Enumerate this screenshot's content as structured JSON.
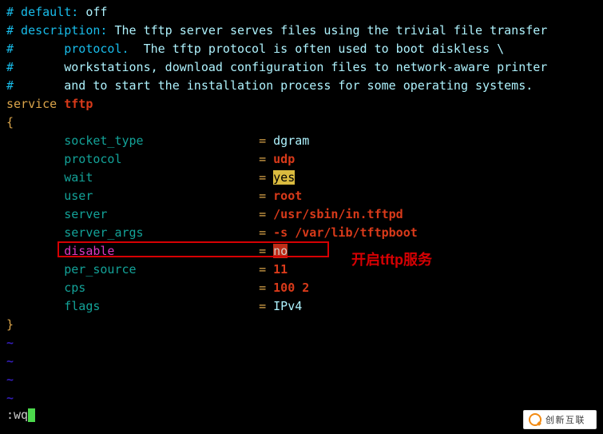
{
  "comments": {
    "l1_a": "# default: ",
    "l1_b": "off",
    "l2_a": "# description: ",
    "l2_b": "The tftp server serves files using the trivial file transfer",
    "l3_a": "#       protocol.  ",
    "l3_b": "The tftp protocol is often used to boot diskless \\",
    "l4_a": "#       ",
    "l4_b": "workstations, download configuration files to network-aware printer",
    "l5_a": "#       ",
    "l5_b": "and to start the installation process for some operating systems."
  },
  "svc": {
    "kw": "service ",
    "name": "tftp",
    "open": "{",
    "close": "}"
  },
  "rows": [
    {
      "k": "socket_type",
      "eq": "= ",
      "v": "dgram",
      "vc": "c-pale"
    },
    {
      "k": "protocol",
      "eq": "= ",
      "v": "udp",
      "vc": "c-red"
    },
    {
      "k": "wait",
      "eq": "= ",
      "v": "yes",
      "vc": "hl-hi"
    },
    {
      "k": "user",
      "eq": "= ",
      "v": "root",
      "vc": "c-red"
    },
    {
      "k": "server",
      "eq": "= ",
      "v": "/usr/sbin/in.tftpd",
      "vc": "c-red"
    },
    {
      "k": "server_args",
      "eq": "= ",
      "v": "-s /var/lib/tftpboot",
      "vc": "c-red"
    },
    {
      "k": "disable",
      "eq": "= ",
      "v": "no",
      "vc": "hl-rd",
      "kc": "c-mag"
    },
    {
      "k": "per_source",
      "eq": "= ",
      "v": "11",
      "vc": "c-red"
    },
    {
      "k": "cps",
      "eq": "= ",
      "v": "100 2",
      "vc": "c-red"
    },
    {
      "k": "flags",
      "eq": "= ",
      "v": "IPv4",
      "vc": "c-pale"
    }
  ],
  "annotation": "开启tftp服务",
  "tilde": "~",
  "cmd_prefix": ":",
  "cmd_text": "wq",
  "watermark": "创新互联"
}
